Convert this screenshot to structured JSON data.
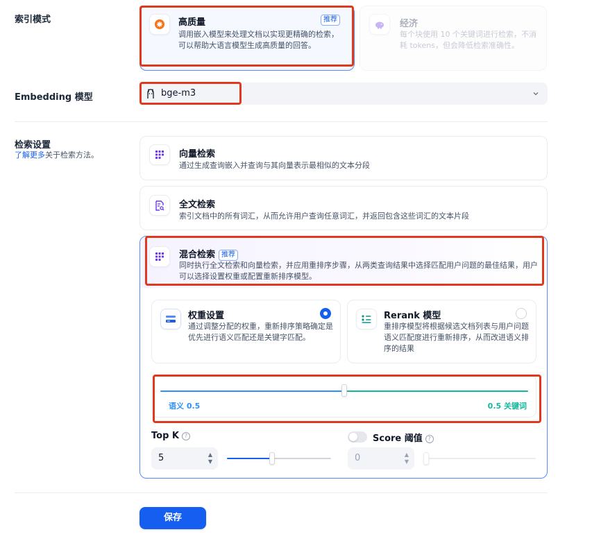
{
  "index_mode": {
    "label": "索引模式",
    "high_quality": {
      "title": "高质量",
      "badge": "推荐",
      "desc": "调用嵌入模型来处理文档以实现更精确的检索，可以帮助大语言模型生成高质量的回答。",
      "icon": "star-burst-icon"
    },
    "economy": {
      "title": "经济",
      "desc": "每个块使用 10 个关键词进行检索，不消耗 tokens，但会降低检索准确性。",
      "icon": "piggy-bank-icon"
    }
  },
  "embedding": {
    "label": "Embedding 模型",
    "value": "bge-m3",
    "icon": "ollama-icon"
  },
  "retrieval": {
    "label": "检索设置",
    "learn_more": "了解更多",
    "learn_more_suffix": "关于检索方法。",
    "vector": {
      "title": "向量检索",
      "desc": "通过生成查询嵌入并查询与其向量表示最相似的文本分段"
    },
    "fulltext": {
      "title": "全文检索",
      "desc": "索引文档中的所有词汇，从而允许用户查询任意词汇，并返回包含这些词汇的文本片段"
    },
    "hybrid": {
      "title": "混合检索",
      "badge": "推荐",
      "desc": "同时执行全文检索和向量检索，并应用重排序步骤，从两类查询结果中选择匹配用户问题的最佳结果，用户可以选择设置权重或配置重新排序模型。",
      "weight": {
        "title": "权重设置",
        "desc": "通过调整分配的权重，重新排序策略确定是优先进行语义匹配还是关键字匹配。",
        "selected": true
      },
      "rerank": {
        "title": "Rerank 模型",
        "desc": "重排序模型将根据候选文档列表与用户问题语义匹配度进行重新排序，从而改进语义排序的结果",
        "selected": false
      },
      "semantic_label": "语义 0.5",
      "keyword_label": "0.5 关键词",
      "semantic_weight": 0.5,
      "top_k": {
        "label": "Top K",
        "value": "5",
        "level": 0.43
      },
      "score": {
        "label": "Score 阈值",
        "value": "0",
        "enabled": false
      }
    }
  },
  "save_label": "保存",
  "colors": {
    "accent": "#155eef",
    "semantic": "#2e90fa",
    "keyword": "#15b79e",
    "highlight": "#e03a1e"
  }
}
